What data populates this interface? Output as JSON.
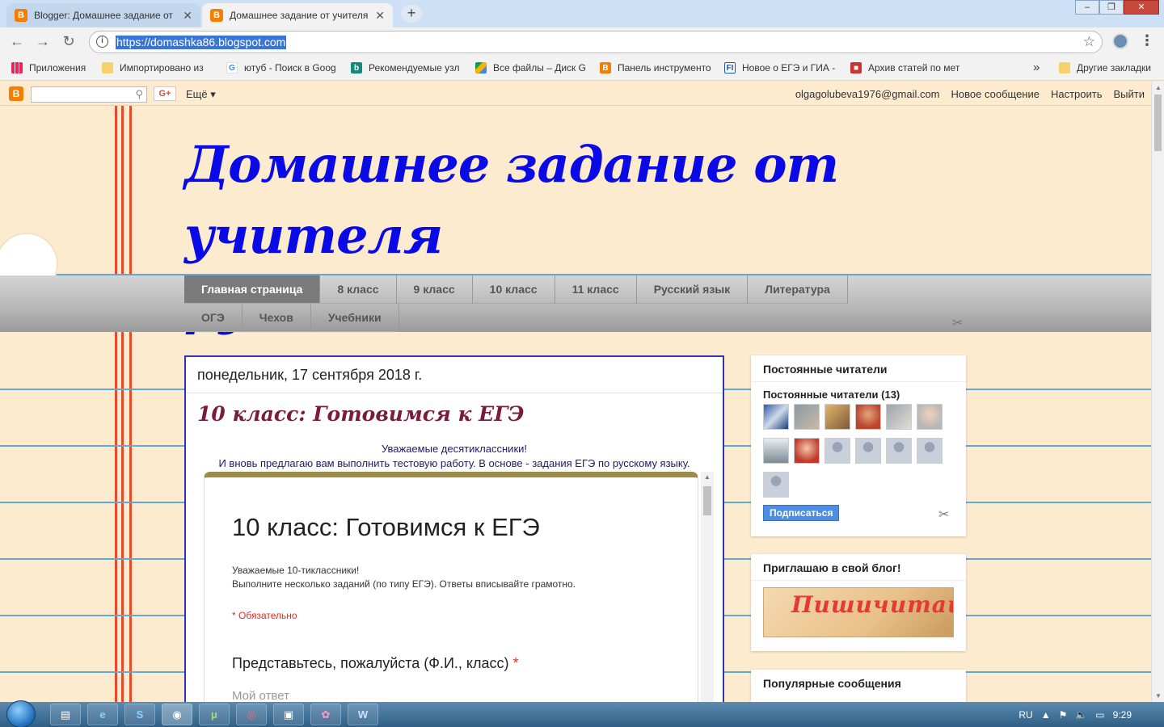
{
  "browser": {
    "tabs": [
      {
        "title": "Blogger: Домашнее задание от",
        "icon": "blogger-icon",
        "active": false
      },
      {
        "title": "Домашнее задание от учителя",
        "icon": "blogger-icon",
        "active": true
      }
    ],
    "url": "https://domashka86.blogspot.com",
    "bookmarks": [
      {
        "label": "Приложения",
        "icon": "apps-grid-icon"
      },
      {
        "label": "Импортировано из",
        "icon": "folder-icon"
      },
      {
        "label": "ютуб - Поиск в Goog",
        "icon": "google-icon"
      },
      {
        "label": "Рекомендуемые узл",
        "icon": "bing-icon"
      },
      {
        "label": "Все файлы – Диск G",
        "icon": "drive-icon"
      },
      {
        "label": "Панель инструменто",
        "icon": "blogger-icon"
      },
      {
        "label": "Новое о ЕГЭ и ГИА -",
        "icon": "fi-icon"
      },
      {
        "label": "Архив статей по мет",
        "icon": "red-icon"
      }
    ],
    "bookmarks_more": "»",
    "other_bookmarks": "Другие закладки"
  },
  "blogger_nav": {
    "more": "Ещё ▾",
    "gplus": "G+",
    "email": "olgagolubeva1976@gmail.com",
    "new_post": "Новое сообщение",
    "customize": "Настроить",
    "logout": "Выйти"
  },
  "header": {
    "title_line1": "Домашнее задание от учителя",
    "title_line2": "русского языка и литературы"
  },
  "pages": [
    "Главная страница",
    "8 класс",
    "9 класс",
    "10 класс",
    "11 класс",
    "Русский язык",
    "Литература",
    "ОГЭ",
    "Чехов",
    "Учебники"
  ],
  "post": {
    "date": "понедельник, 17 сентября 2018 г.",
    "title": "10 класс: Готовимся к ЕГЭ",
    "intro_line1": "Уважаемые десятиклассники!",
    "intro_line2": "И вновь предлагаю вам выполнить тестовую работу. В основе - задания ЕГЭ по русскому языку.",
    "form": {
      "title": "10 класс: Готовимся к ЕГЭ",
      "desc_line1": "Уважаемые 10-тиклассники!",
      "desc_line2": "Выполните несколько заданий (по типу ЕГЭ). Ответы вписывайте грамотно.",
      "required": "* Обязательно",
      "question": "Представьтесь, пожалуйста (Ф.И., класс)",
      "question_required_mark": "*",
      "answer_placeholder": "Мой ответ"
    }
  },
  "sidebar": {
    "followers_title": "Постоянные читатели",
    "followers_count": "Постоянные читатели (13)",
    "subscribe": "Подписаться",
    "blog_title": "Приглашаю в свой блог!",
    "banner_text": "Пишичитай",
    "popular_title": "Популярные сообщения"
  },
  "taskbar": {
    "lang": "RU",
    "time": "9:29"
  },
  "colors": {
    "title_blue": "#0a0ae6",
    "post_title": "#7a1c3c",
    "page_bg": "#fdebd0",
    "rule_blue": "#5ea9d9",
    "red_line": "#e64a2e"
  }
}
